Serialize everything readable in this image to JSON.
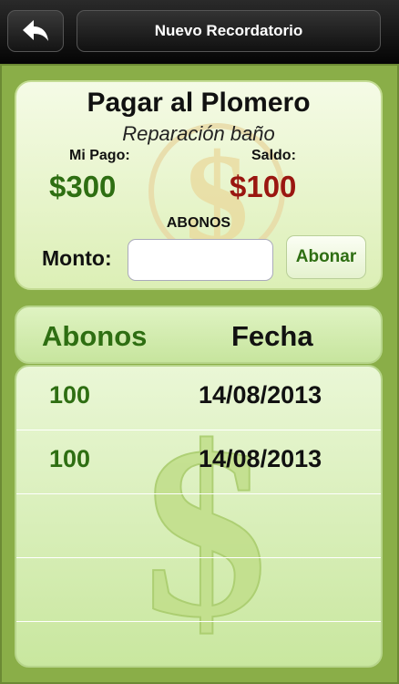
{
  "nav": {
    "title": "Nuevo Recordatorio",
    "back_icon": "back-arrow-icon"
  },
  "reminder": {
    "title": "Pagar al Plomero",
    "subtitle": "Reparación baño",
    "my_payment_label": "Mi Pago:",
    "my_payment_value": "$300",
    "balance_label": "Saldo:",
    "balance_value": "$100",
    "section_label": "ABONOS",
    "amount_label": "Monto:",
    "amount_value": "",
    "pay_button": "Abonar"
  },
  "table": {
    "headers": [
      "Abonos",
      "Fecha"
    ],
    "rows": [
      {
        "amount": "100",
        "date": "14/08/2013"
      },
      {
        "amount": "100",
        "date": "14/08/2013"
      },
      {
        "amount": "",
        "date": ""
      },
      {
        "amount": "",
        "date": ""
      }
    ]
  },
  "colors": {
    "accent_green": "#2e6e12",
    "balance_red": "#9a1610",
    "background": "#8aae48"
  }
}
